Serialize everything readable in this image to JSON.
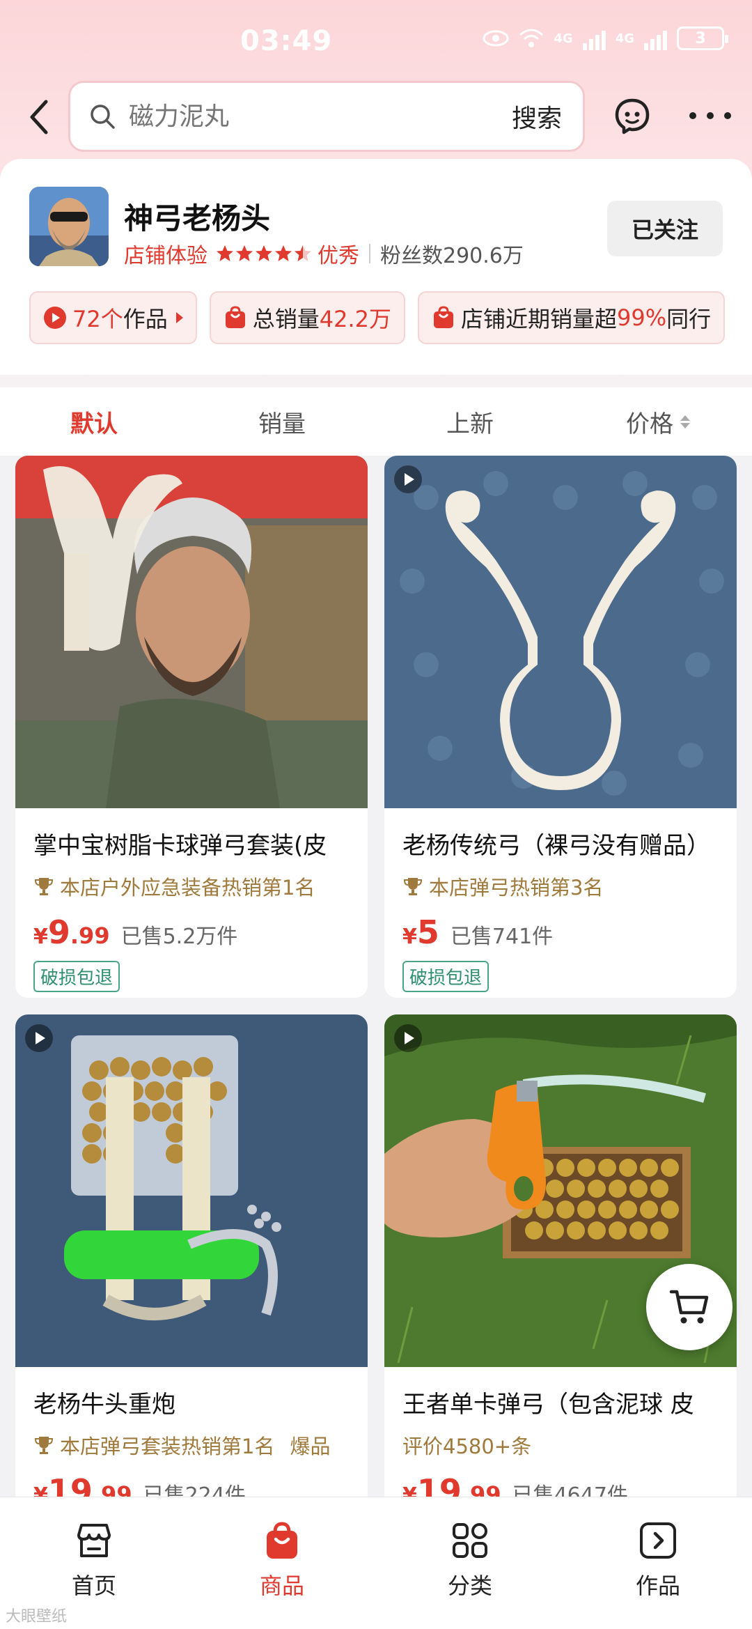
{
  "status_bar": {
    "time": "03:49",
    "battery": "3"
  },
  "search": {
    "placeholder": "磁力泥丸",
    "button_label": "搜索"
  },
  "shop": {
    "name": "神弓老杨头",
    "experience_label": "店铺体验",
    "rating_stars": 4.5,
    "rating_text": "优秀",
    "fans": "粉丝数290.6万",
    "follow_label": "已关注"
  },
  "chips": [
    {
      "value": "72个",
      "label": "作品"
    },
    {
      "label": "总销量",
      "value": "42.2万"
    },
    {
      "label": "店铺近期销量超",
      "value": "99%",
      "suffix": "同行"
    }
  ],
  "tabs": [
    "默认",
    "销量",
    "上新",
    "价格"
  ],
  "products": [
    {
      "title": "掌中宝树脂卡球弹弓套装(皮",
      "rank": "本店户外应急装备热销第1名",
      "price_currency": "¥",
      "price_int": "9",
      "price_dec": ".99",
      "sold": "已售5.2万件",
      "tag": "破损包退"
    },
    {
      "title": "老杨传统弓（裸弓没有赠品）",
      "rank": "本店弹弓热销第3名",
      "price_currency": "¥",
      "price_int": "5",
      "price_dec": "",
      "sold": "已售741件",
      "tag": "破损包退"
    },
    {
      "title": "老杨牛头重炮",
      "rank": "本店弹弓套装热销第1名",
      "rank_hot": "爆品",
      "price_currency": "¥",
      "price_int": "19",
      "price_dec": ".99",
      "sold": "已售224件"
    },
    {
      "title": "王者单卡弹弓（包含泥球  皮",
      "review": "评价4580+条",
      "price_currency": "¥",
      "price_int": "19",
      "price_dec": ".99",
      "sold": "已售4647件"
    }
  ],
  "bottom_nav": [
    {
      "label": "首页",
      "icon": "shop-home-icon"
    },
    {
      "label": "商品",
      "icon": "shopping-bag-icon"
    },
    {
      "label": "分类",
      "icon": "category-grid-icon"
    },
    {
      "label": "作品",
      "icon": "video-works-icon"
    }
  ],
  "watermark": "大眼壁纸",
  "colors": {
    "accent": "#e03a2f",
    "rank_gold": "#a07a3c",
    "tag_green": "#2e9070"
  }
}
